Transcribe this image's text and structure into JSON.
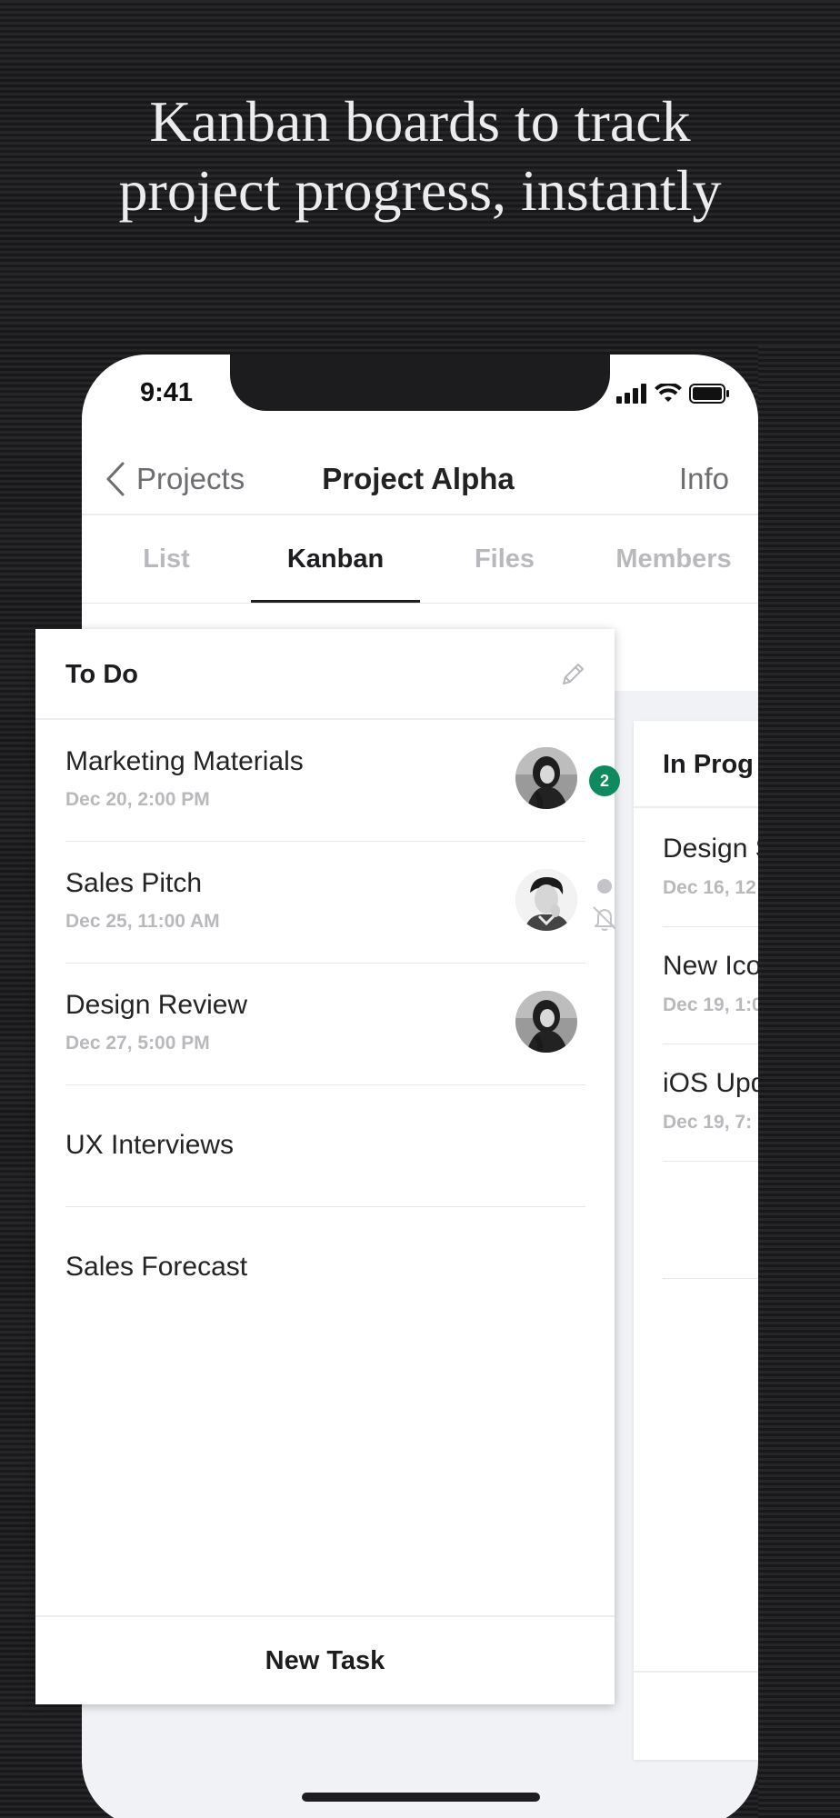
{
  "headline": {
    "line1": "Kanban boards to track",
    "line2": "project progress, instantly"
  },
  "status_bar": {
    "time": "9:41"
  },
  "nav": {
    "back_label": "Projects",
    "title": "Project Alpha",
    "info_label": "Info"
  },
  "tabs": [
    {
      "label": "List",
      "active": false
    },
    {
      "label": "Kanban",
      "active": true
    },
    {
      "label": "Files",
      "active": false
    },
    {
      "label": "Members",
      "active": false
    }
  ],
  "todo_column": {
    "title": "To Do",
    "tasks": [
      {
        "title": "Marketing Materials",
        "date": "Dec 20, 2:00 PM",
        "badge": "2"
      },
      {
        "title": "Sales Pitch",
        "date": "Dec 25, 11:00 AM"
      },
      {
        "title": "Design Review",
        "date": "Dec 27, 5:00 PM"
      },
      {
        "title": "UX Interviews"
      },
      {
        "title": "Sales Forecast"
      }
    ],
    "new_task_label": "New Task"
  },
  "in_progress_column": {
    "title": "In Prog",
    "tasks": [
      {
        "title": "Design S",
        "date": "Dec 16, 12"
      },
      {
        "title": "New Ico",
        "date": "Dec 19, 1:0"
      },
      {
        "title": "iOS Upd",
        "date": "Dec 19, 7:"
      }
    ]
  },
  "colors": {
    "badge": "#0e8a5f",
    "background": "#1c1c1e",
    "board_background": "#f1f2f6"
  },
  "icons": {
    "back": "chevron-left-icon",
    "edit": "pencil-icon",
    "mute": "bell-off-icon",
    "signal": "cellular-signal-icon",
    "wifi": "wifi-icon",
    "battery": "battery-icon"
  }
}
